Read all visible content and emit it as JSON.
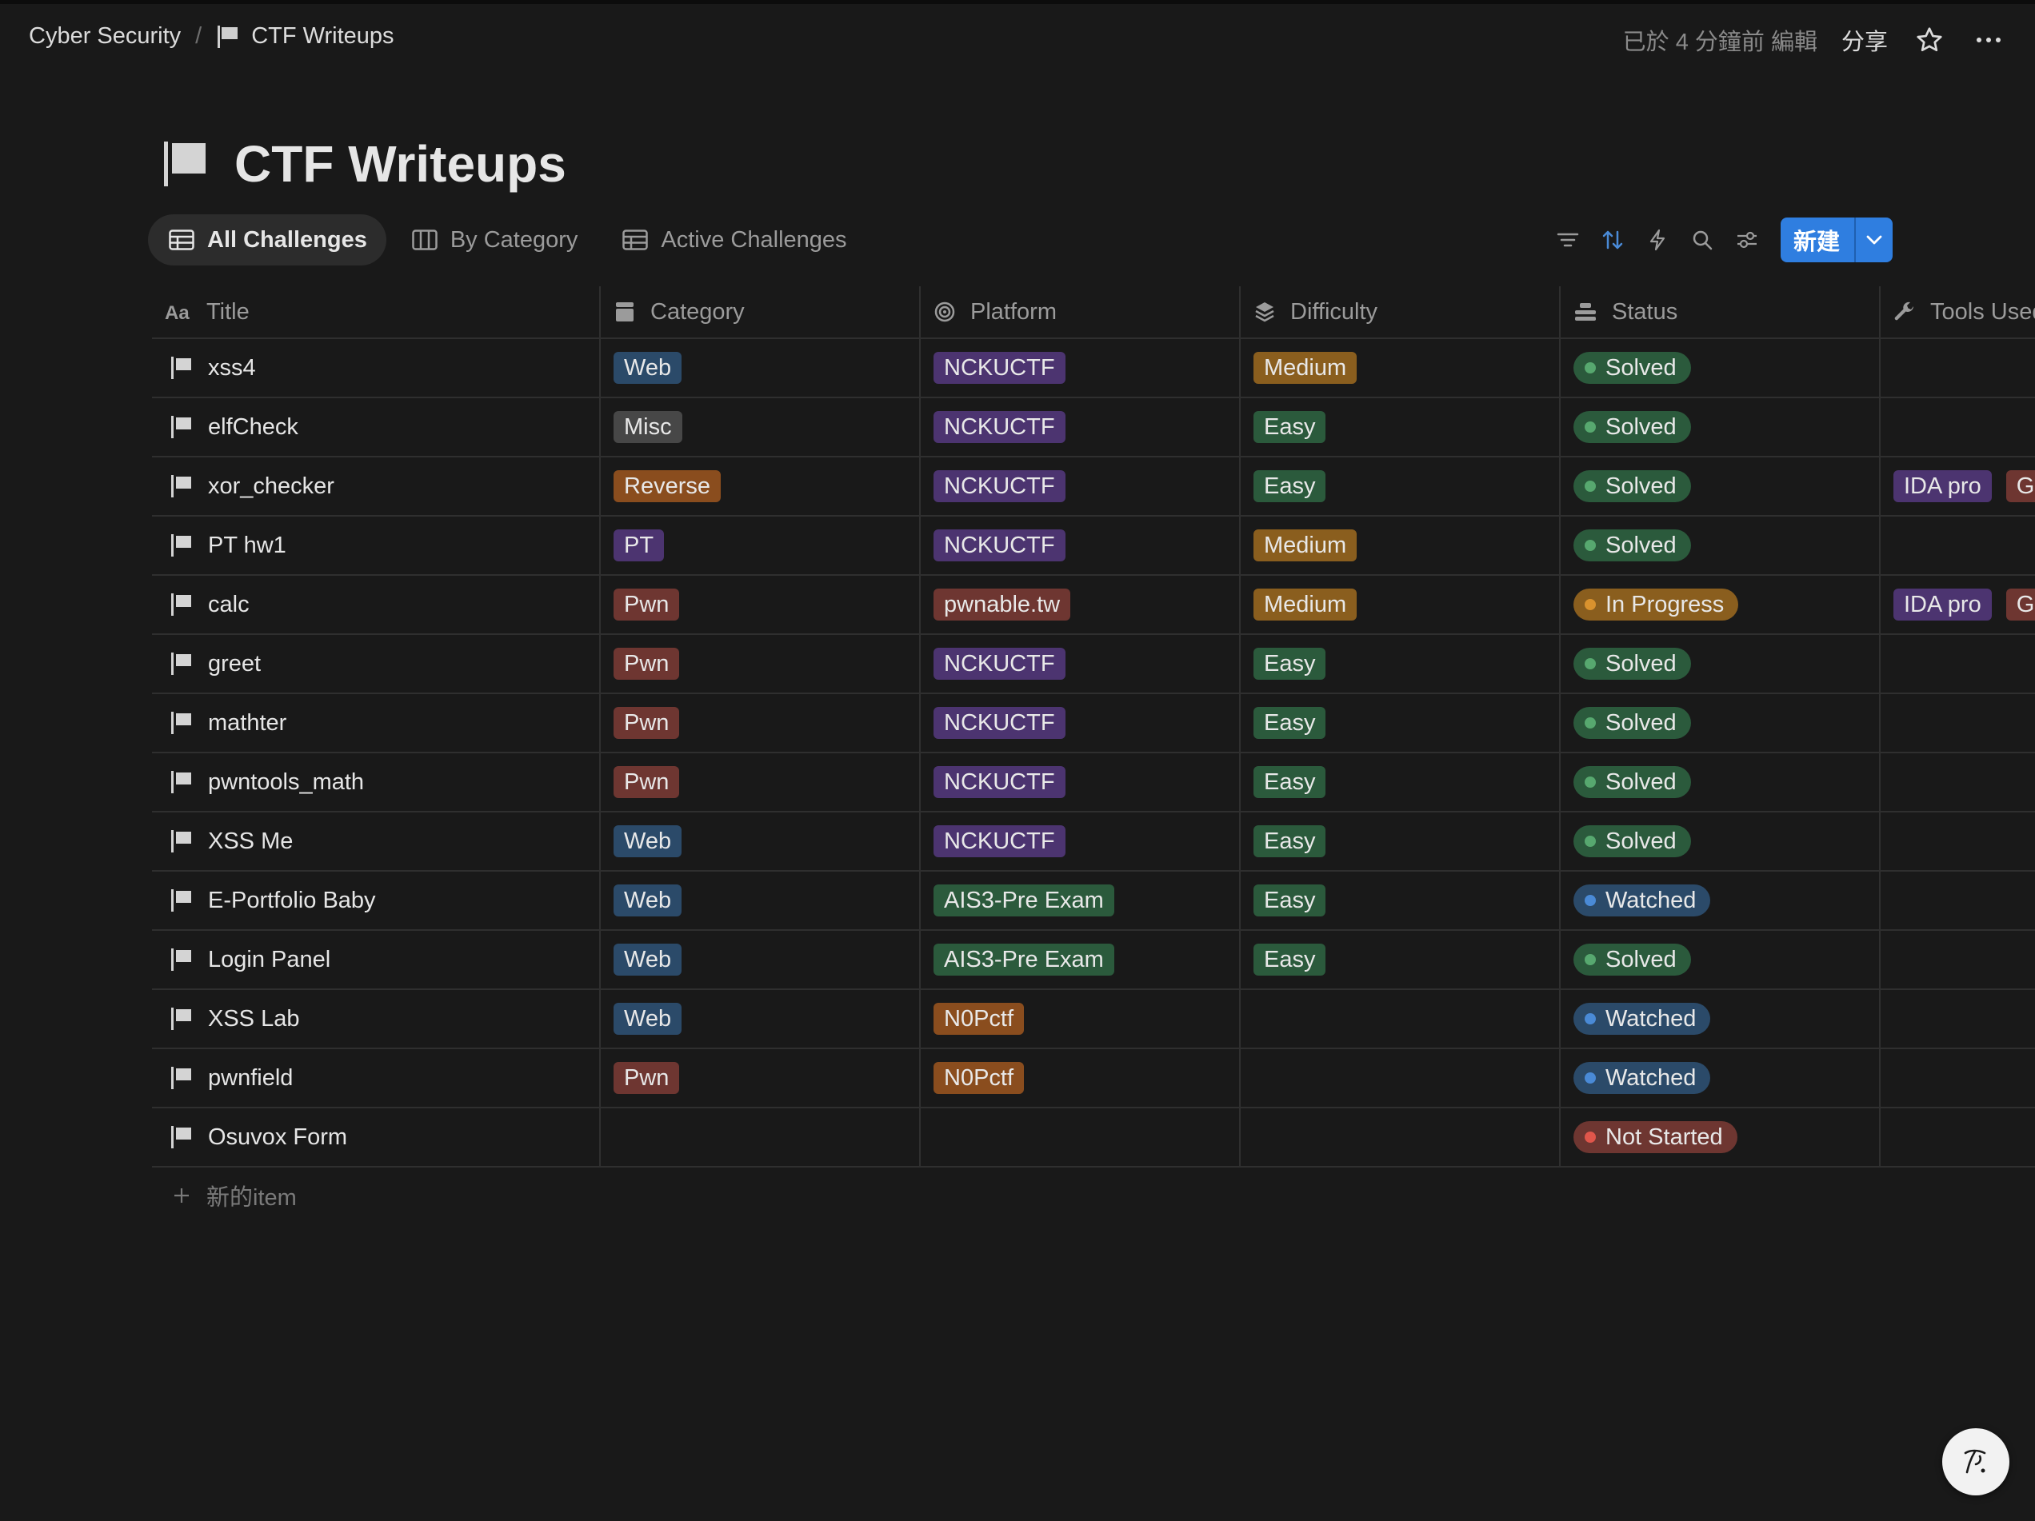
{
  "breadcrumb": {
    "parent": "Cyber Security",
    "separator": "/",
    "current": "CTF Writeups"
  },
  "topbar": {
    "edited": "已於 4 分鐘前 編輯",
    "share": "分享"
  },
  "page": {
    "title": "CTF Writeups"
  },
  "views": [
    {
      "label": "All Challenges",
      "active": true
    },
    {
      "label": "By Category",
      "active": false
    },
    {
      "label": "Active Challenges",
      "active": false
    }
  ],
  "toolbar": {
    "new_label": "新建",
    "accent": "#2f7ee0"
  },
  "columns": {
    "title": "Title",
    "category": "Category",
    "platform": "Platform",
    "difficulty": "Difficulty",
    "status": "Status",
    "tools": "Tools Used"
  },
  "tag_colors": {
    "Web": "#2b4a69",
    "Misc": "#474747",
    "Reverse": "#8a4d1e",
    "PT": "#4c3470",
    "Pwn": "#6e3631",
    "NCKUCTF": "#4c3470",
    "pwnable.tw": "#6e3631",
    "AIS3-Pre Exam": "#2b5a3c",
    "N0Pctf": "#8a4d1e",
    "Medium": "#8a5e1e",
    "Easy": "#2b5a3c",
    "IDA pro": "#4c3470",
    "GDB": "#6e3631"
  },
  "status_colors": {
    "Solved": {
      "bg": "#2b5a3c",
      "dot": "#57a86f"
    },
    "In Progress": {
      "bg": "#8a5e1e",
      "dot": "#d9922e"
    },
    "Watched": {
      "bg": "#2b4a69",
      "dot": "#4a8ad6"
    },
    "Not Started": {
      "bg": "#6e3631",
      "dot": "#e0564b"
    }
  },
  "rows": [
    {
      "title": "xss4",
      "category": "Web",
      "platform": "NCKUCTF",
      "difficulty": "Medium",
      "status": "Solved",
      "tools": []
    },
    {
      "title": "elfCheck",
      "category": "Misc",
      "platform": "NCKUCTF",
      "difficulty": "Easy",
      "status": "Solved",
      "tools": []
    },
    {
      "title": "xor_checker",
      "category": "Reverse",
      "platform": "NCKUCTF",
      "difficulty": "Easy",
      "status": "Solved",
      "tools": [
        "IDA pro",
        "GDB"
      ]
    },
    {
      "title": "PT hw1",
      "category": "PT",
      "platform": "NCKUCTF",
      "difficulty": "Medium",
      "status": "Solved",
      "tools": []
    },
    {
      "title": "calc",
      "category": "Pwn",
      "platform": "pwnable.tw",
      "difficulty": "Medium",
      "status": "In Progress",
      "tools": [
        "IDA pro",
        "GDB"
      ]
    },
    {
      "title": "greet",
      "category": "Pwn",
      "platform": "NCKUCTF",
      "difficulty": "Easy",
      "status": "Solved",
      "tools": []
    },
    {
      "title": "mathter",
      "category": "Pwn",
      "platform": "NCKUCTF",
      "difficulty": "Easy",
      "status": "Solved",
      "tools": []
    },
    {
      "title": "pwntools_math",
      "category": "Pwn",
      "platform": "NCKUCTF",
      "difficulty": "Easy",
      "status": "Solved",
      "tools": []
    },
    {
      "title": "XSS Me",
      "category": "Web",
      "platform": "NCKUCTF",
      "difficulty": "Easy",
      "status": "Solved",
      "tools": []
    },
    {
      "title": "E-Portfolio Baby",
      "category": "Web",
      "platform": "AIS3-Pre Exam",
      "difficulty": "Easy",
      "status": "Watched",
      "tools": []
    },
    {
      "title": "Login Panel",
      "category": "Web",
      "platform": "AIS3-Pre Exam",
      "difficulty": "Easy",
      "status": "Solved",
      "tools": []
    },
    {
      "title": "XSS Lab",
      "category": "Web",
      "platform": "N0Pctf",
      "difficulty": "",
      "status": "Watched",
      "tools": []
    },
    {
      "title": "pwnfield",
      "category": "Pwn",
      "platform": "N0Pctf",
      "difficulty": "",
      "status": "Watched",
      "tools": []
    },
    {
      "title": "Osuvox Form",
      "category": "",
      "platform": "",
      "difficulty": "",
      "status": "Not Started",
      "tools": []
    }
  ],
  "new_item_label": "新的item"
}
